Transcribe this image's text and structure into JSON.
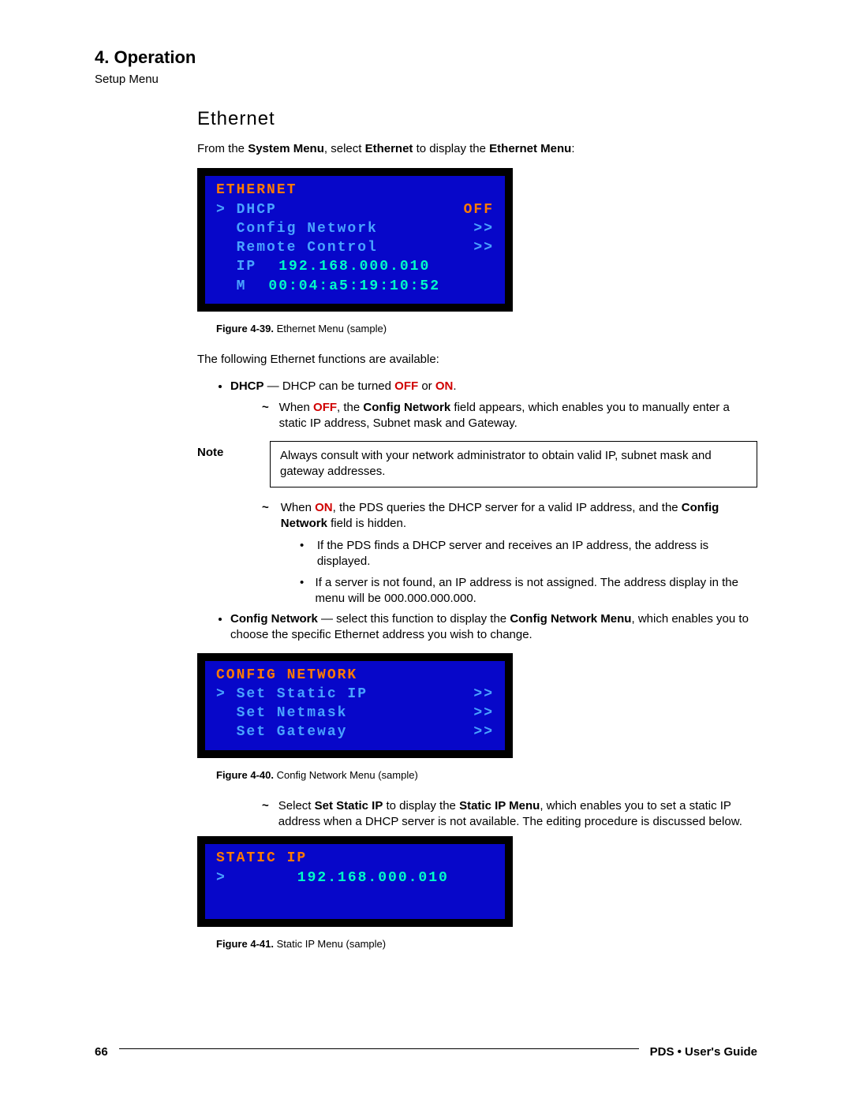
{
  "chapter": "4.  Operation",
  "sectionLabel": "Setup Menu",
  "heading": "Ethernet",
  "intro": {
    "pre": "From the ",
    "b1": "System Menu",
    "mid": ", select ",
    "b2": "Ethernet",
    "mid2": " to display the ",
    "b3": "Ethernet Menu",
    "post": ":"
  },
  "menu1": {
    "title": "ETHERNET",
    "rows": [
      {
        "left": "> DHCP",
        "right": "OFF",
        "rightClass": "off"
      },
      {
        "left": "  Config Network",
        "right": ">>",
        "rightClass": "arrows"
      },
      {
        "left": "  Remote Control",
        "right": ">>",
        "rightClass": "arrows"
      }
    ],
    "ip": {
      "label": "  IP",
      "value": "192.168.000.010"
    },
    "mac": {
      "label": "  M",
      "value": "00:04:a5:19:10:52"
    }
  },
  "fig1": {
    "num": "Figure 4-39.",
    "text": "Ethernet Menu  (sample)"
  },
  "afterFig1": "The following Ethernet functions are available:",
  "bullet1": {
    "b": "DHCP",
    "dash": " — DHCP can be turned ",
    "off": "OFF",
    "or": " or ",
    "on": "ON",
    "dot": "."
  },
  "tilde_off": {
    "pre": "When ",
    "state": "OFF",
    "mid": ", the ",
    "b": "Config Network",
    "post": " field appears, which enables you to manually enter a static IP address, Subnet mask and Gateway."
  },
  "noteLabel": "Note",
  "noteBody": "Always consult with your network administrator to obtain valid IP, subnet mask and gateway addresses.",
  "tilde_on": {
    "pre": "When ",
    "state": "ON",
    "mid": ", the PDS queries the DHCP server for a valid IP address, and the ",
    "b": "Config Network",
    "post": " field is hidden."
  },
  "dot1": "If the PDS finds a DHCP server and receives an IP address, the address is displayed.",
  "dot2": "If a server is not found, an IP address is not assigned. The address display in the menu will be 000.000.000.000.",
  "bullet2": {
    "b1": "Config Network",
    "dash": " — select this function to display the ",
    "b2": "Config Network Menu",
    "post": ", which enables you to choose the specific Ethernet address you wish to change."
  },
  "menu2": {
    "title": "CONFIG NETWORK",
    "rows": [
      {
        "left": "> Set Static IP",
        "right": ">>"
      },
      {
        "left": "  Set Netmask",
        "right": ">>"
      },
      {
        "left": "  Set Gateway",
        "right": ">>"
      }
    ]
  },
  "fig2": {
    "num": "Figure 4-40.",
    "text": "Config Network Menu (sample)"
  },
  "tilde_static": {
    "pre": "Select ",
    "b1": "Set Static IP",
    "mid": " to display the ",
    "b2": "Static IP Menu",
    "post": ", which enables you to set a static IP address when a DHCP server is not available.  The editing procedure is discussed below."
  },
  "menu3": {
    "title": "STATIC IP",
    "row": {
      "left": ">",
      "value": "192.168.000.010"
    }
  },
  "fig3": {
    "num": "Figure 4-41.",
    "text": "Static IP Menu  (sample)"
  },
  "footer": {
    "page": "66",
    "doc": "PDS  •  User's Guide"
  }
}
